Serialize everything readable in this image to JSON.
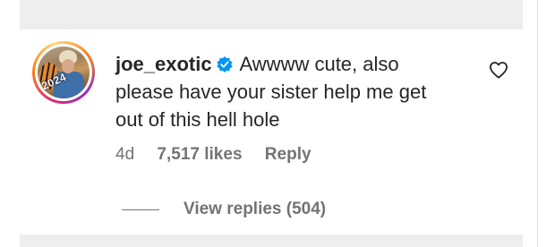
{
  "comment": {
    "username": "joe_exotic",
    "verified": true,
    "text": "Awwww cute, also please have your sister help me get out of this hell hole",
    "time": "4d",
    "likes": "7,517 likes",
    "reply_label": "Reply",
    "view_replies_label": "View replies (504)",
    "avatar": {
      "badge_text": "2024",
      "icon": "profile-photo"
    }
  },
  "icons": {
    "verified": "verified-badge-icon",
    "like": "heart-outline-icon"
  },
  "colors": {
    "verified": "#0095f6",
    "text": "#262626",
    "secondary_text": "#737373",
    "divider_background": "#eeeeee"
  }
}
